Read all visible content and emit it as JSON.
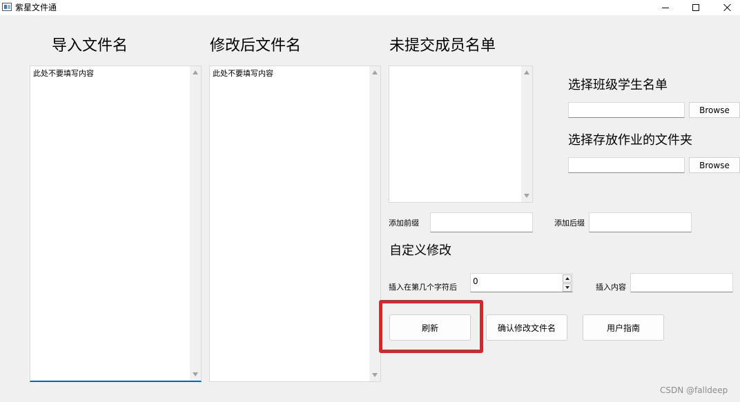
{
  "window": {
    "title": "紫星文件通",
    "minimize_icon": "minimize-icon",
    "maximize_icon": "maximize-icon",
    "close_icon": "close-icon"
  },
  "columns": {
    "import": {
      "heading": "导入文件名",
      "content": "此处不要填写内容"
    },
    "modified": {
      "heading": "修改后文件名",
      "content": "此处不要填写内容"
    },
    "unsubmitted": {
      "heading": "未提交成员名单",
      "content": ""
    }
  },
  "class_list": {
    "label": "选择班级学生名单",
    "value": "",
    "browse_label": "Browse"
  },
  "homework_folder": {
    "label": "选择存放作业的文件夹",
    "value": "",
    "browse_label": "Browse"
  },
  "prefix": {
    "label": "添加前缀",
    "value": ""
  },
  "suffix": {
    "label": "添加后缀",
    "value": ""
  },
  "custom": {
    "heading": "自定义修改",
    "insert_position_label": "插入在第几个字符后",
    "insert_position_value": "0",
    "insert_content_label": "插入内容",
    "insert_content_value": ""
  },
  "buttons": {
    "refresh": "刷新",
    "confirm_rename": "确认修改文件名",
    "user_guide": "用户指南"
  },
  "highlight_color": "#e0202a",
  "watermark": "CSDN @falldeep"
}
